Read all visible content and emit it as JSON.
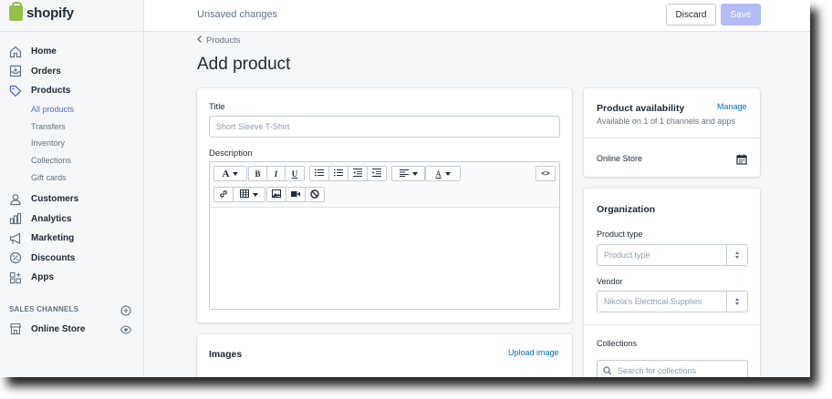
{
  "brand": {
    "name": "shopify",
    "color": "#95bf47"
  },
  "colors": {
    "accent": "#5c6ac4",
    "save_disabled": "#b3bcf5",
    "link": "#006fbb"
  },
  "sidebar": {
    "items": [
      {
        "label": "Home",
        "icon": "home-icon"
      },
      {
        "label": "Orders",
        "icon": "orders-icon"
      },
      {
        "label": "Products",
        "icon": "tag-icon"
      }
    ],
    "product_subitems": [
      "All products",
      "Transfers",
      "Inventory",
      "Collections",
      "Gift cards"
    ],
    "more_items": [
      {
        "label": "Customers",
        "icon": "customers-icon"
      },
      {
        "label": "Analytics",
        "icon": "analytics-icon"
      },
      {
        "label": "Marketing",
        "icon": "megaphone-icon"
      },
      {
        "label": "Discounts",
        "icon": "discount-icon"
      },
      {
        "label": "Apps",
        "icon": "apps-icon"
      }
    ],
    "sales_channels_label": "SALES CHANNELS",
    "online_store": "Online Store"
  },
  "topbar": {
    "status": "Unsaved changes",
    "discard": "Discard",
    "save": "Save"
  },
  "breadcrumb": "Products",
  "page_title": "Add product",
  "form": {
    "title_label": "Title",
    "title_placeholder": "Short Sleeve T-Shirt",
    "description_label": "Description"
  },
  "images": {
    "title": "Images",
    "upload": "Upload image"
  },
  "availability": {
    "title": "Product availability",
    "manage": "Manage",
    "summary": "Available on 1 of 1 channels and apps",
    "channel": "Online Store"
  },
  "organization": {
    "title": "Organization",
    "product_type_label": "Product type",
    "product_type_placeholder": "Product type",
    "vendor_label": "Vendor",
    "vendor_value": "Nikola's Electrical Supplies",
    "collections_label": "Collections",
    "collections_placeholder": "Search for collections"
  }
}
